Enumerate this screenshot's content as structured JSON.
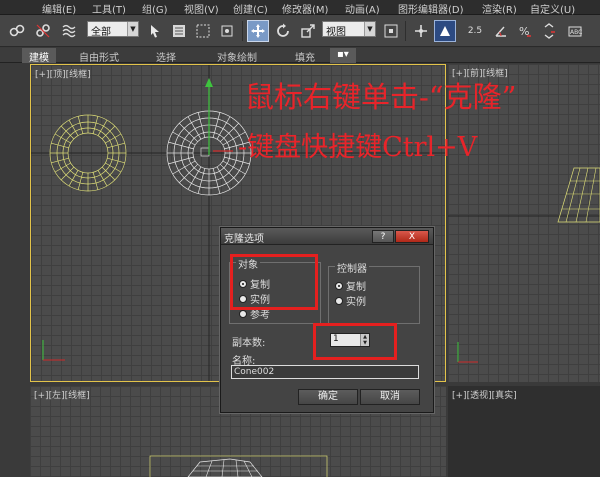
{
  "menu": [
    "编辑(E)",
    "工具(T)",
    "组(G)",
    "视图(V)",
    "创建(C)",
    "修改器(M)",
    "动画(A)",
    "图形编辑器(D)",
    "渲染(R)",
    "自定义(U)"
  ],
  "toolbar": {
    "selection_filter": "全部",
    "reference_coord": "视图",
    "snap_label": "2.5",
    "icons": [
      "link-icon",
      "unlink-icon",
      "bind-spacewarp-icon",
      "select-object-icon",
      "select-by-name-icon",
      "rect-region-icon",
      "window-crossing-icon",
      "select-move-icon",
      "select-rotate-icon",
      "select-scale-icon",
      "pivot-icon",
      "manipulate-icon",
      "snap-icon",
      "angle-snap-icon",
      "percent-snap-icon",
      "spinner-snap-icon",
      "edit-named-selection-icon"
    ]
  },
  "ribbon": {
    "tabs": [
      "建模",
      "自由形式",
      "选择",
      "对象绘制",
      "填充"
    ]
  },
  "viewports": {
    "top": "[+][顶][线框]",
    "front": "[+][前][线框]",
    "left": "[+][左][线框]",
    "perspective": "[+][透视][真实]"
  },
  "annotations": {
    "line1": "鼠标右键单击-“克隆”",
    "line2": "-键盘快捷键Ctrl+V"
  },
  "dialog": {
    "title": "克隆选项",
    "help": "?",
    "close": "X",
    "object_group": "对象",
    "object_options": [
      "复制",
      "实例",
      "参考"
    ],
    "controller_group": "控制器",
    "controller_options": [
      "复制",
      "实例"
    ],
    "copies_label": "副本数:",
    "copies_value": "1",
    "name_label": "名称:",
    "name_value": "Cone002",
    "ok": "确定",
    "cancel": "取消"
  },
  "colors": {
    "annotation_red": "#e8242a",
    "highlight_box": "#e5201f",
    "active_viewport_border": "#e2c34a",
    "selected_wire": "#e6e6e6",
    "unselected_wire": "#dede78",
    "gizmo_y": "#3ec43e"
  }
}
